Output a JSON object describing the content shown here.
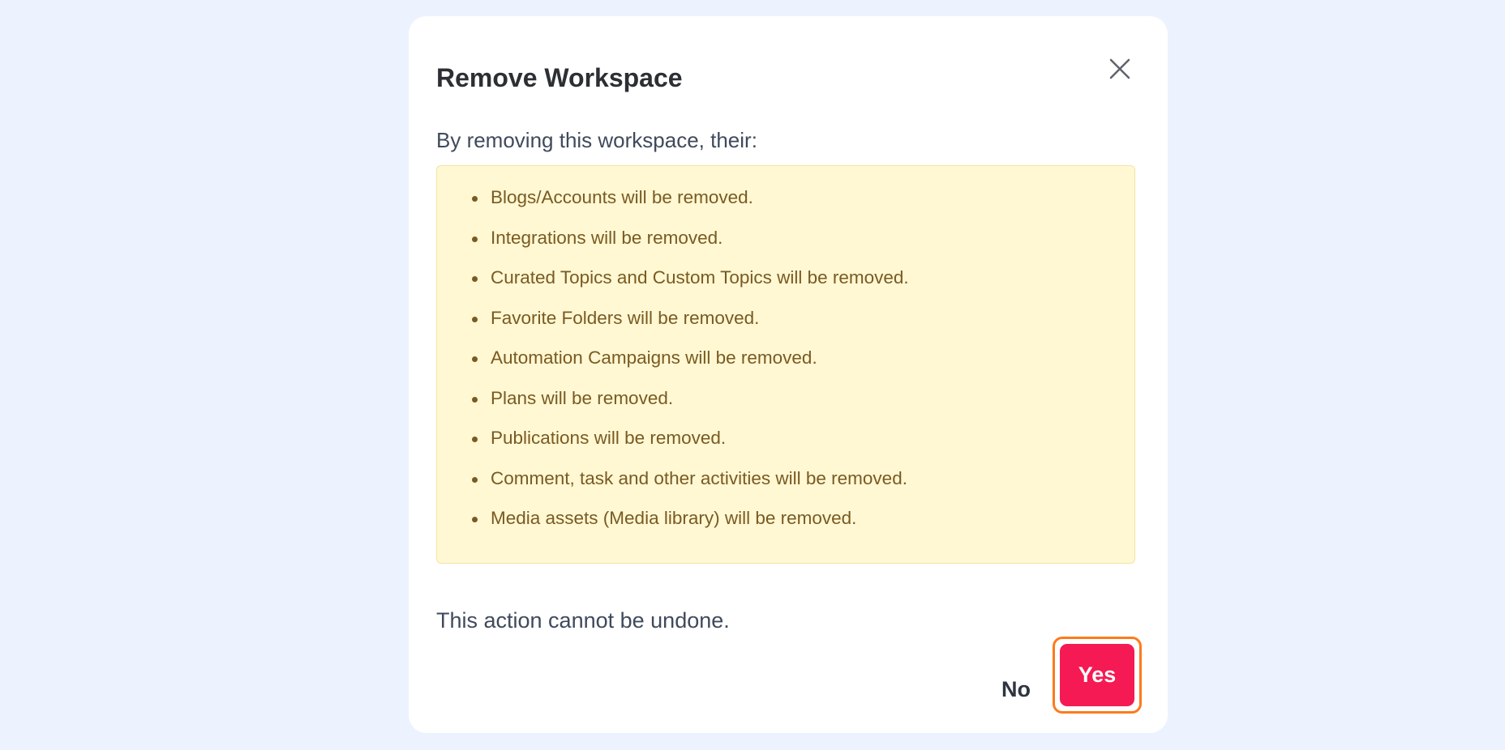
{
  "dialog": {
    "title": "Remove Workspace",
    "intro": "By removing this workspace, their:",
    "items": [
      {
        "text": "Blogs/Accounts will be removed."
      },
      {
        "text": "Integrations will be removed."
      },
      {
        "text": "Curated Topics and Custom Topics will be removed."
      },
      {
        "text": "Favorite Folders will be removed."
      },
      {
        "text": "Automation Campaigns will be removed."
      },
      {
        "text": "Plans will be removed."
      },
      {
        "text": "Publications will be removed."
      },
      {
        "text": "Comment, task and other activities will be removed."
      },
      {
        "text": "Media assets (Media library) will be removed."
      }
    ],
    "note": "This action cannot be undone.",
    "no_label": "No",
    "yes_label": "Yes",
    "close_icon": "close-icon"
  },
  "colors": {
    "page_background": "#ecf3ff",
    "warning_background": "#fff8d3",
    "warning_text": "#7a5a22",
    "yes_button": "#f51a53",
    "focus_outline": "#ff7a1a"
  }
}
